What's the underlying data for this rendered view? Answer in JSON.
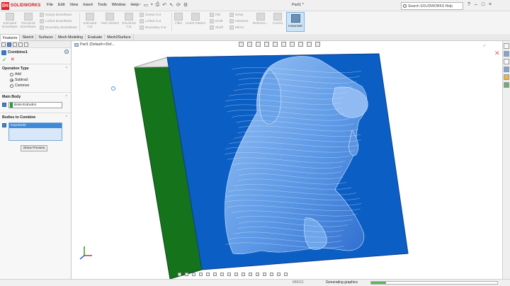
{
  "app": {
    "brand_badge": "DS",
    "brand": "SOLIDWORKS",
    "doc_title": "Part1 *",
    "search_placeholder": "Search SOLIDWORKS Help",
    "menu": [
      "File",
      "Edit",
      "View",
      "Insert",
      "Tools",
      "Window",
      "Help"
    ],
    "window_controls": [
      "?",
      "–",
      "□",
      "×"
    ]
  },
  "ribbon": {
    "extruded_boss": "Extruded Boss/Base",
    "revolved_boss": "Revolved Boss/Base",
    "swept_boss": "Swept Boss/Base",
    "lofted_boss": "Lofted Boss/Base",
    "boundary_boss": "Boundary Boss/Base",
    "extruded_cut": "Extruded Cut",
    "hole_wizard": "Hole Wizard",
    "revolved_cut": "Revolved Cut",
    "swept_cut": "Swept Cut",
    "lofted_cut": "Lofted Cut",
    "boundary_cut": "Boundary Cut",
    "fillet": "Fillet",
    "linear_pattern": "Linear Pattern",
    "rib": "Rib",
    "draft": "Draft",
    "shell": "Shell",
    "wrap": "Wrap",
    "intersect": "Intersect",
    "mirror": "Mirror",
    "reference": "Referenc...",
    "curves": "Curves",
    "instant3d": "Instant3D"
  },
  "tabs": [
    "Features",
    "Sketch",
    "Surfaces",
    "Mesh Modeling",
    "Evaluate",
    "Mesh2Surface"
  ],
  "panel": {
    "title": "Combine1",
    "help": "?",
    "ok": "✓",
    "cancel": "✕",
    "operation_type": {
      "label": "Operation Type",
      "options": [
        "Add",
        "Subtract",
        "Common"
      ],
      "selected": "Subtract"
    },
    "main_body": {
      "label": "Main Body",
      "value": "Boss-Extrude1"
    },
    "bodies_to_combine": {
      "label": "Bodies to Combine",
      "items": [
        "Imported3"
      ]
    },
    "show_preview": "Show Preview",
    "collapse_glyph": "⌃"
  },
  "viewport": {
    "tree_flyout": "Part1  (Default<<Def...",
    "confirm_ok": "✓",
    "confirm_cancel": "✕",
    "colors": {
      "box_front": "#0b5fc4",
      "box_side": "#15731c",
      "box_top": "#e6e6e6",
      "mesh": "#7fb0ee",
      "mesh_line": "#dbe9ff"
    }
  },
  "status": {
    "units": "MMGS",
    "message": "Generating graphics",
    "progress": 0.12
  }
}
